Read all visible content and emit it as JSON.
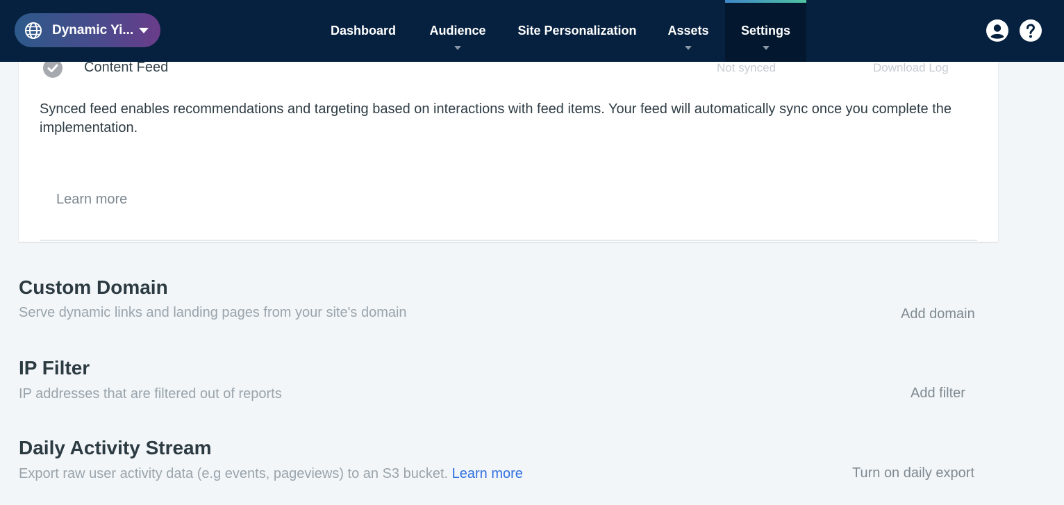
{
  "header": {
    "site_name": "Dynamic Yi...",
    "nav": [
      {
        "label": "Dashboard",
        "has_submenu": false
      },
      {
        "label": "Audience",
        "has_submenu": true
      },
      {
        "label": "Site Personalization",
        "has_submenu": false
      },
      {
        "label": "Assets",
        "has_submenu": true
      },
      {
        "label": "Settings",
        "has_submenu": true,
        "active": true
      }
    ],
    "icons": {
      "account": "user-circle-icon",
      "help": "help-circle-icon"
    }
  },
  "feed_card": {
    "feed_name": "Content Feed",
    "status": "Not synced",
    "download_log": "Download Log",
    "description": "Synced feed enables recommendations and targeting based on interactions with feed items. Your feed will automatically sync once you complete the implementation.",
    "learn_more": "Learn more"
  },
  "sections": {
    "custom_domain": {
      "title": "Custom Domain",
      "description": "Serve dynamic links and landing pages from your site's domain",
      "action": "Add domain"
    },
    "ip_filter": {
      "title": "IP Filter",
      "description": "IP addresses that are filtered out of reports",
      "action": "Add filter"
    },
    "daily_activity": {
      "title": "Daily Activity Stream",
      "description": "Export raw user activity data (e.g events, pageviews) to an S3 bucket.",
      "link": "Learn more",
      "action": "Turn on daily export"
    }
  },
  "colors": {
    "nav_bg": "#06213f",
    "page_bg": "#f2f6f9",
    "link": "#2f6fe0",
    "active_accent": "#4fc3a1"
  }
}
